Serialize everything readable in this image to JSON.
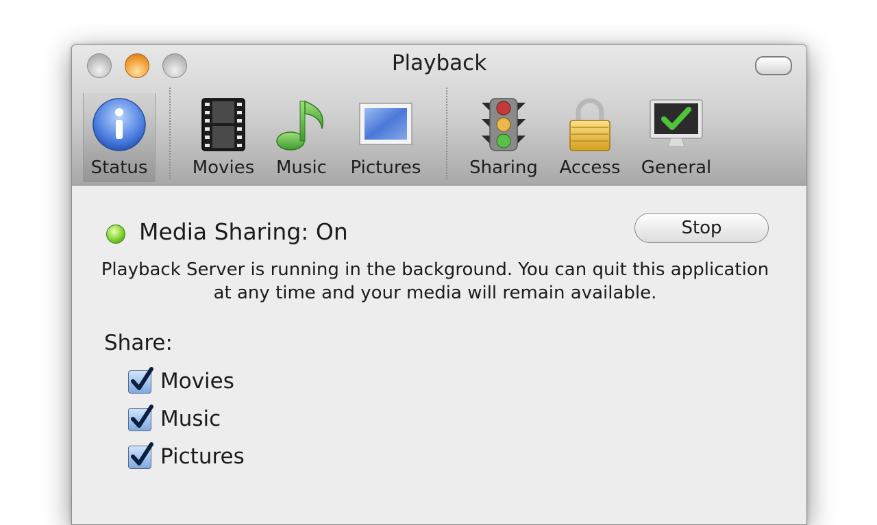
{
  "window": {
    "title": "Playback"
  },
  "toolbar": {
    "items": [
      {
        "label": "Status",
        "icon": "info-icon",
        "selected": true
      },
      {
        "label": "Movies",
        "icon": "film-icon"
      },
      {
        "label": "Music",
        "icon": "music-note-icon"
      },
      {
        "label": "Pictures",
        "icon": "picture-icon"
      },
      {
        "label": "Sharing",
        "icon": "traffic-light-icon"
      },
      {
        "label": "Access",
        "icon": "padlock-icon"
      },
      {
        "label": "General",
        "icon": "monitor-check-icon"
      }
    ]
  },
  "status": {
    "label": "Media Sharing: On",
    "indicator_color": "#7fd12c",
    "stop_label": "Stop",
    "description": "Playback Server is running in the background. You can quit this application at any time and your media will remain available."
  },
  "share": {
    "label": "Share:",
    "options": [
      {
        "label": "Movies",
        "checked": true
      },
      {
        "label": "Music",
        "checked": true
      },
      {
        "label": "Pictures",
        "checked": true
      }
    ]
  }
}
